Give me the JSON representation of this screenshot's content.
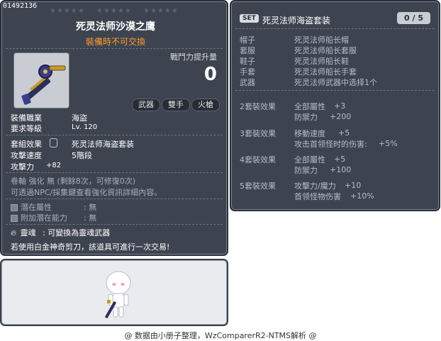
{
  "item": {
    "id": "01492136",
    "stars": [
      "★★★★★",
      "★★★★★",
      "★★★★★"
    ],
    "name": "死灵法师沙漠之鹰",
    "trade_status": "裝備時不可交換",
    "power_label": "戰鬥力提升量",
    "power_value": "0",
    "tags": [
      "武器",
      "雙手",
      "火槍"
    ],
    "job_label": "裝備職業",
    "job_value": "海盜",
    "level_label": "要求等級",
    "level_value": "Lv. 120",
    "set_label": "套組效果",
    "set_value": "死灵法师海盗套装",
    "speed_label": "攻擊速度",
    "speed_value": "5階段",
    "attack_label": "攻擊力",
    "attack_value": "+82",
    "upgrade_text": "卷軸 強化 無 (剩餘8次，可修復0次)",
    "info_text": "可透過NPC/採集鍵查看強化資訊詳細內容。",
    "potential_label": "潛在屬性",
    "potential_value": ": 無",
    "bonus_potential_label": "附加潛在能力",
    "bonus_potential_value": ": 無",
    "soul_label": "靈魂",
    "soul_value": ": 可變換為靈魂武器",
    "scissors_text": "若使用白金神奇剪刀，該道具可進行一次交易!"
  },
  "set": {
    "badge": "SET",
    "name": "死灵法师海盗套装",
    "count": "0 / 5",
    "pieces": [
      {
        "slot": "帽子",
        "name": "死灵法师船长帽"
      },
      {
        "slot": "套服",
        "name": "死灵法师船长套服"
      },
      {
        "slot": "鞋子",
        "name": "死灵法师船长鞋"
      },
      {
        "slot": "手套",
        "name": "死灵法师船长手套"
      },
      {
        "slot": "武器",
        "name": "死灵法师武器中选择1个"
      }
    ],
    "effects": [
      {
        "label": "2套裝效果",
        "lines": [
          {
            "stat": "全部屬性",
            "value": "+3"
          },
          {
            "stat": "防禦力",
            "value": "+200"
          }
        ]
      },
      {
        "label": "3套裝效果",
        "lines": [
          {
            "stat": "移動速度",
            "value": "+5"
          },
          {
            "stat": "攻击首领怪时的伤害:",
            "value": "+5%"
          }
        ]
      },
      {
        "label": "4套裝效果",
        "lines": [
          {
            "stat": "全部屬性",
            "value": "+5"
          },
          {
            "stat": "防禦力",
            "value": "+100"
          }
        ]
      },
      {
        "label": "5套裝效果",
        "lines": [
          {
            "stat": "攻擊力/魔力",
            "value": "+10"
          },
          {
            "stat": "首领怪物伤害",
            "value": "+10%"
          }
        ]
      }
    ]
  },
  "footer": "@ 数据由小册子整理，WzComparerR2-NTMS解析 @"
}
